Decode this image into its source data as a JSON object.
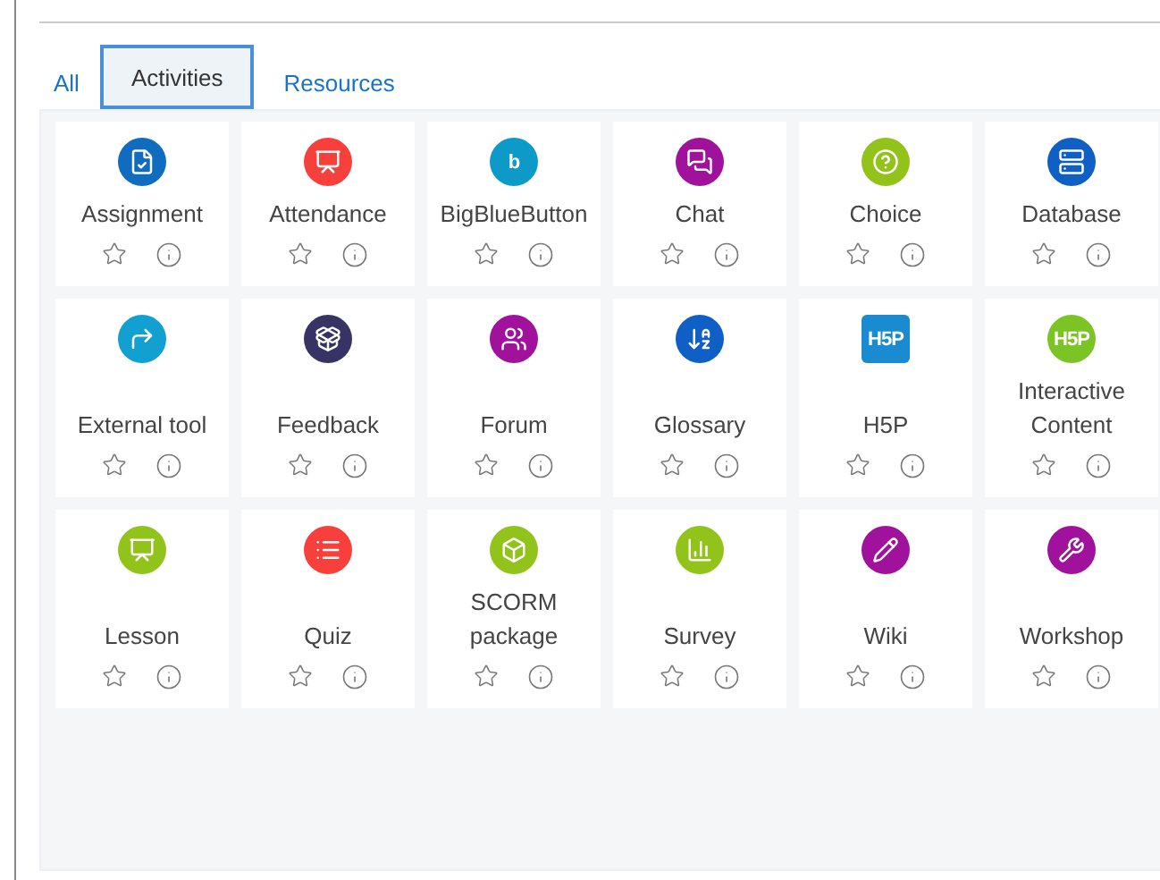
{
  "tabs": [
    {
      "label": "All",
      "selected": false
    },
    {
      "label": "Activities",
      "selected": true
    },
    {
      "label": "Resources",
      "selected": false
    }
  ],
  "modules": [
    {
      "name": "Assignment",
      "kind": "assignment",
      "color": "#0f6cbf"
    },
    {
      "name": "Attendance",
      "kind": "attendance",
      "color": "#f7403c"
    },
    {
      "name": "BigBlueButton",
      "kind": "logo",
      "logo_text": "b",
      "color": "#0d9ac9"
    },
    {
      "name": "Chat",
      "kind": "chat",
      "color": "#a0129b"
    },
    {
      "name": "Choice",
      "kind": "choice",
      "color": "#92c31a"
    },
    {
      "name": "Database",
      "kind": "database",
      "color": "#0f5fc4"
    },
    {
      "name": "External tool",
      "kind": "external",
      "color": "#12a0d1"
    },
    {
      "name": "Feedback",
      "kind": "feedback",
      "color": "#373364"
    },
    {
      "name": "Forum",
      "kind": "forum",
      "color": "#a0129b"
    },
    {
      "name": "Glossary",
      "kind": "glossary",
      "color": "#0f5fc4"
    },
    {
      "name": "H5P",
      "kind": "logo_square",
      "logo_text": "H5P",
      "color": "#1a8bd1"
    },
    {
      "name": "Interactive Content",
      "kind": "logo",
      "logo_text": "H5P",
      "color": "#7cc326"
    },
    {
      "name": "Lesson",
      "kind": "lesson",
      "color": "#92c31a"
    },
    {
      "name": "Quiz",
      "kind": "quiz",
      "color": "#f7403c"
    },
    {
      "name": "SCORM package",
      "kind": "scorm",
      "color": "#92c31a"
    },
    {
      "name": "Survey",
      "kind": "survey",
      "color": "#92c31a"
    },
    {
      "name": "Wiki",
      "kind": "wiki",
      "color": "#a0129b"
    },
    {
      "name": "Workshop",
      "kind": "workshop",
      "color": "#a0129b"
    }
  ]
}
